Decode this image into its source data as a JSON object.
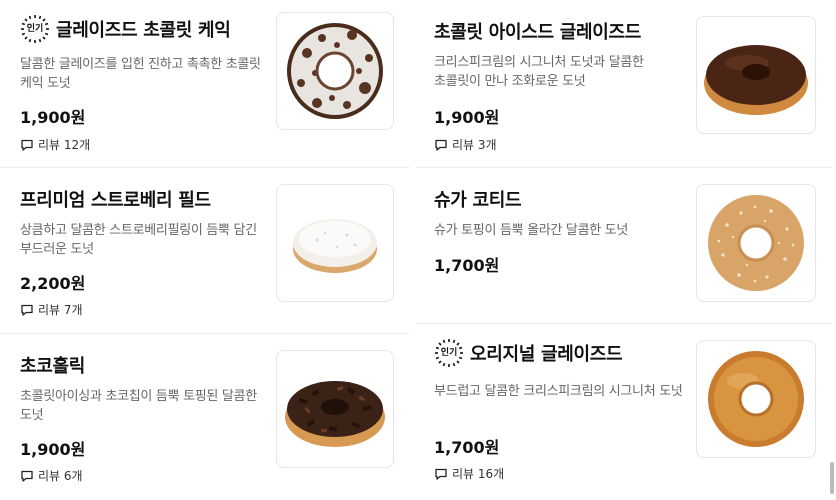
{
  "products": {
    "left": [
      {
        "badge": "인기",
        "title": "글레이즈드 초콜릿 케익",
        "desc": "달콤한 글레이즈를 입힌 진하고 촉촉한 초콜릿 케익 도넛",
        "price": "1,900원",
        "reviews": "리뷰 12개",
        "image_icon": "chocolate-glazed-cake-donut"
      },
      {
        "title": "프리미엄 스트로베리 필드",
        "desc": "상큼하고 달콤한 스트로베리필링이 듬뿍 담긴 부드러운 도넛",
        "price": "2,200원",
        "reviews": "리뷰 7개",
        "image_icon": "powdered-filled-donut"
      },
      {
        "title": "초코홀릭",
        "desc": "초콜릿아이싱과 초코칩이 듬뿍 토핑된 달콤한 도넛",
        "price": "1,900원",
        "reviews": "리뷰 6개",
        "image_icon": "choco-chip-donut"
      }
    ],
    "right": [
      {
        "title": "초콜릿 아이스드 글레이즈드",
        "desc": "크리스피크림의 시그니처 도넛과 달콤한 초콜릿이 만나 조화로운 도넛",
        "price": "1,900원",
        "reviews": "리뷰 3개",
        "image_icon": "chocolate-iced-donut"
      },
      {
        "title": "슈가 코티드",
        "desc": "슈가 토핑이 듬뿍 올라간 달콤한 도넛",
        "price": "1,700원",
        "image_icon": "sugar-coated-donut"
      },
      {
        "badge": "인기",
        "title": "오리지널 글레이즈드",
        "desc": "부드럽고 달콤한 크리스피크림의 시그니처 도넛",
        "price": "1,700원",
        "reviews": "리뷰 16개",
        "image_icon": "original-glazed-donut"
      }
    ]
  },
  "colors": {
    "title": "#111111",
    "description": "#666666",
    "divider": "#eeeeee",
    "thumb_border": "#e6e6e6"
  }
}
